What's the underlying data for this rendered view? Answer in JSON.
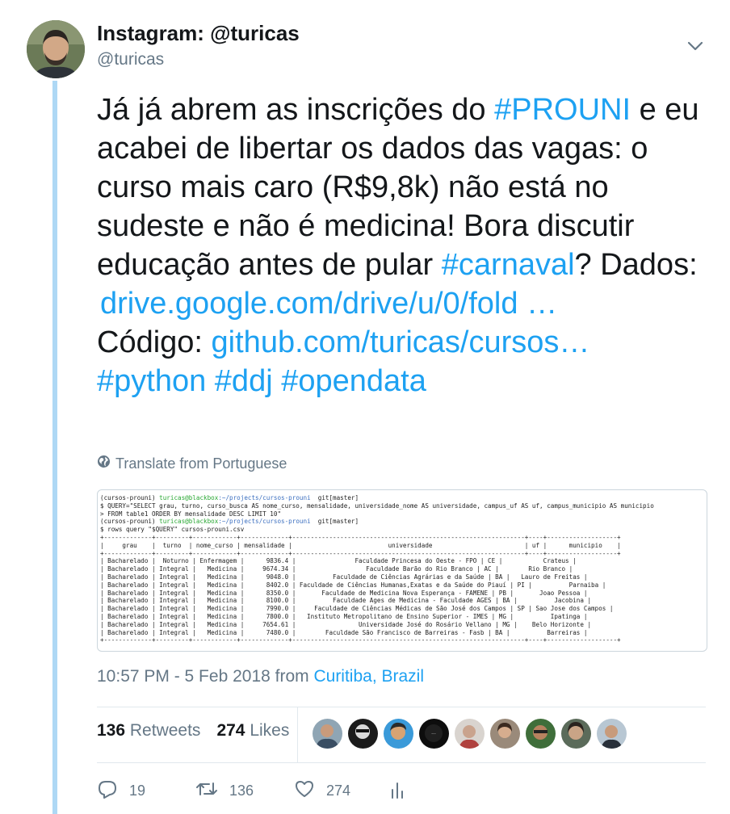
{
  "author": {
    "display_name": "Instagram: @turicas",
    "handle": "@turicas"
  },
  "tweet": {
    "t1": "Já já abrem as inscrições do ",
    "hashtag_prouni": "#PROUNI",
    "t2": " e eu acabei de libertar os dados das vagas: o curso mais caro (R$9,8k) não está no sudeste e não é medicina! Bora discutir educação antes de pular ",
    "hashtag_carnaval": "#carnaval",
    "t3": "? Dados: ",
    "link_drive": "drive.google.com/drive/u/0/fold …",
    "t4": "Código: ",
    "link_github": "github.com/turicas/cursos…",
    "hashtag_python": "#python",
    "hashtag_ddj": "#ddj",
    "hashtag_opendata": "#opendata"
  },
  "translate_label": "Translate from Portuguese",
  "terminal": {
    "lines": [
      {
        "p1": "(cursos-prouni) ",
        "user": "turicas@blackbox",
        "path": ":~/projects/cursos-prouni",
        "rest": "  git[master]"
      },
      {
        "text": "$ QUERY=\"SELECT grau, turno, curso_busca AS nome_curso, mensalidade, universidade_nome AS universidade, campus_uf AS uf, campus_municipio AS municipio"
      },
      {
        "text": "> FROM table1 ORDER BY mensalidade DESC LIMIT 10\""
      },
      {
        "p1": "(cursos-prouni) ",
        "user": "turicas@blackbox",
        "path": ":~/projects/cursos-prouni",
        "rest": "  git[master]"
      },
      {
        "text": "$ rows query \"$QUERY\" cursos-prouni.csv"
      },
      {
        "text": "+-------------+---------+------------+-------------+---------------------------------------------------------------+----+-------------------+"
      },
      {
        "text": "|     grau    |  turno  | nome_curso | mensalidade |                          universidade                         | uf |      municipio    |"
      },
      {
        "text": "+-------------+---------+------------+-------------+---------------------------------------------------------------+----+-------------------+"
      },
      {
        "text": "| Bacharelado |  Noturno | Enfermagem |      9836.4 |                Faculdade Princesa do Oeste - FPO | CE |           Crateus |"
      },
      {
        "text": "| Bacharelado | Integral |   Medicina |     9674.34 |                   Faculdade Barão do Rio Branco | AC |        Rio Branco |"
      },
      {
        "text": "| Bacharelado | Integral |   Medicina |      9048.0 |          Faculdade de Ciências Agrárias e da Saúde | BA |   Lauro de Freitas |"
      },
      {
        "text": "| Bacharelado | Integral |   Medicina |      8402.0 | Faculdade de Ciências Humanas,Exatas e da Saúde do Piauí | PI |          Parnaiba |"
      },
      {
        "text": "| Bacharelado | Integral |   Medicina |      8350.0 |       Faculdade de Medicina Nova Esperança - FAMENE | PB |       Joao Pessoa |"
      },
      {
        "text": "| Bacharelado | Integral |   Medicina |      8100.0 |          Faculdade Ages de Medicina - Faculdade AGES | BA |          Jacobina |"
      },
      {
        "text": "| Bacharelado | Integral |   Medicina |      7990.0 |     Faculdade de Ciências Médicas de São José dos Campos | SP | Sao Jose dos Campos |"
      },
      {
        "text": "| Bacharelado | Integral |   Medicina |      7800.0 |   Instituto Metropolitano de Ensino Superior - IMES | MG |          Ipatinga |"
      },
      {
        "text": "| Bacharelado | Integral |   Medicina |     7654.61 |                 Universidade José do Rosário Vellano | MG |    Belo Horizonte |"
      },
      {
        "text": "| Bacharelado | Integral |   Medicina |      7480.0 |        Faculdade São Francisco de Barreiras - Fasb | BA |          Barreiras |"
      },
      {
        "text": "+-------------+---------+------------+-------------+---------------------------------------------------------------+----+-------------------+"
      }
    ]
  },
  "timestamp": {
    "time_date": "10:57 PM - 5 Feb 2018 from ",
    "location": "Curitiba, Brazil"
  },
  "stats": {
    "retweets_count": "136",
    "retweets_label": "Retweets",
    "likes_count": "274",
    "likes_label": "Likes"
  },
  "actions": {
    "reply_count": "19",
    "retweet_count": "136",
    "like_count": "274"
  },
  "icons": {
    "chevron": "chevron-down-icon",
    "globe": "globe-icon",
    "reply": "reply-icon",
    "retweet": "retweet-icon",
    "like": "heart-icon",
    "analytics": "analytics-icon"
  },
  "colors": {
    "link": "#1da1f2",
    "thread_line": "#aed8f5",
    "secondary_text": "#657786"
  }
}
